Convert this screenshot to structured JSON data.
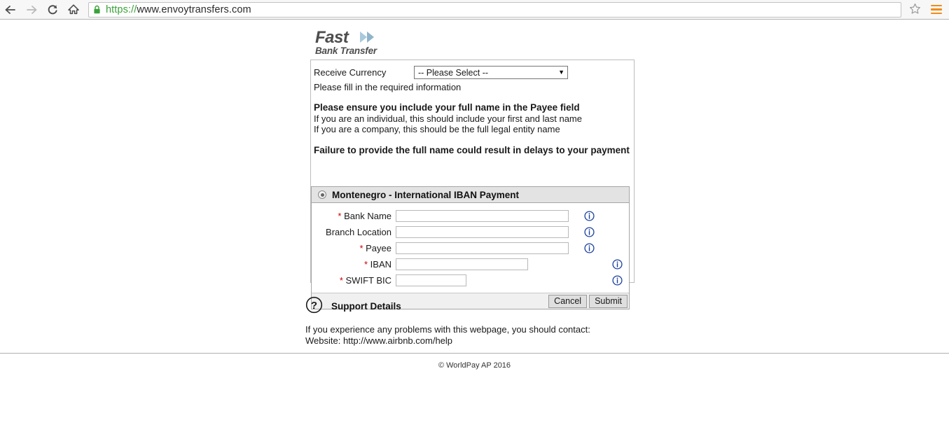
{
  "browser": {
    "back_icon": "arrow-left-icon",
    "forward_icon": "arrow-right-icon",
    "reload_icon": "reload-icon",
    "home_icon": "home-icon",
    "lock_icon": "padlock-icon",
    "url_scheme": "https://",
    "url_rest": "www.envoytransfers.com",
    "bookmark_icon": "star-icon",
    "menu_icon": "hamburger-menu-icon"
  },
  "logo": {
    "line1": "Fast",
    "line2": "Bank Transfer",
    "arrow_icon": "chevron-arrow-icon"
  },
  "form": {
    "currency_label": "Receive Currency",
    "currency_selected": "-- Please Select --",
    "currency_caret": "▼",
    "fill_note": "Please fill in the required information",
    "ensure_title": "Please ensure you include your full name in the Payee field",
    "ensure_line1": "If you are an individual, this should include your first and last name",
    "ensure_line2": "If you are a company, this should be the full legal entity name",
    "failure_line": "Failure to provide the full name could result in delays to your payment"
  },
  "panel": {
    "radio_name": "payment-method-radio",
    "title": "Montenegro - International IBAN Payment",
    "fields": [
      {
        "label": "Bank Name",
        "required": true,
        "value": "",
        "width": "w-long",
        "info_icon": "info-icon"
      },
      {
        "label": "Branch Location",
        "required": false,
        "value": "",
        "width": "w-long",
        "info_icon": "info-icon"
      },
      {
        "label": "Payee",
        "required": true,
        "value": "",
        "width": "w-long",
        "info_icon": "info-icon"
      },
      {
        "label": "IBAN",
        "required": true,
        "value": "",
        "width": "w-med",
        "info_icon": "info-icon"
      },
      {
        "label": "SWIFT BIC",
        "required": true,
        "value": "",
        "width": "w-short",
        "info_icon": "info-icon"
      }
    ],
    "cancel_label": "Cancel",
    "submit_label": "Submit"
  },
  "support": {
    "icon": "question-mark-icon",
    "title": "Support Details",
    "line1": "If you experience any problems with this webpage, you should contact:",
    "line2": "Website: http://www.airbnb.com/help"
  },
  "footer": {
    "copyright": "© WorldPay AP 2016"
  },
  "colors": {
    "required_asterisk": "#cc0000",
    "info_blue": "#1a3fa0",
    "url_green": "#3ba23b",
    "menu_orange": "#f08c19",
    "panel_header": "#e3e3e3"
  }
}
